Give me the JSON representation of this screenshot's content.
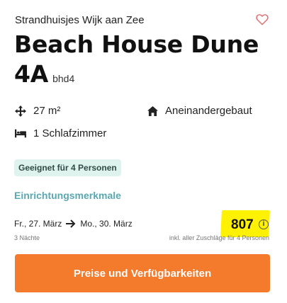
{
  "listing": {
    "location": "Strandhuisjes Wijk aan Zee",
    "title": "Beach House Dune 4A",
    "code": "bhd4",
    "favorite_icon": "heart-outline-icon"
  },
  "features": {
    "area": "27 m²",
    "building_type": "Aneinandergebaut",
    "bedrooms": "1 Schlafzimmer"
  },
  "badge": {
    "label": "Geeignet für 4 Personen"
  },
  "amenities_link": {
    "label": "Einrichtungsmerkmale"
  },
  "stay": {
    "from": "Fr., 27. März",
    "to": "Mo., 30. März",
    "nights": "3 Nächte"
  },
  "price": {
    "amount": "807",
    "note": "inkl. aller Zuschläge für 4 Personen",
    "highlight_color": "#fff200"
  },
  "cta": {
    "label": "Preise und Verfügbarkeiten",
    "color": "#f47a2c"
  },
  "colors": {
    "link": "#5aa8b0",
    "badge_bg": "#dff3ee"
  }
}
